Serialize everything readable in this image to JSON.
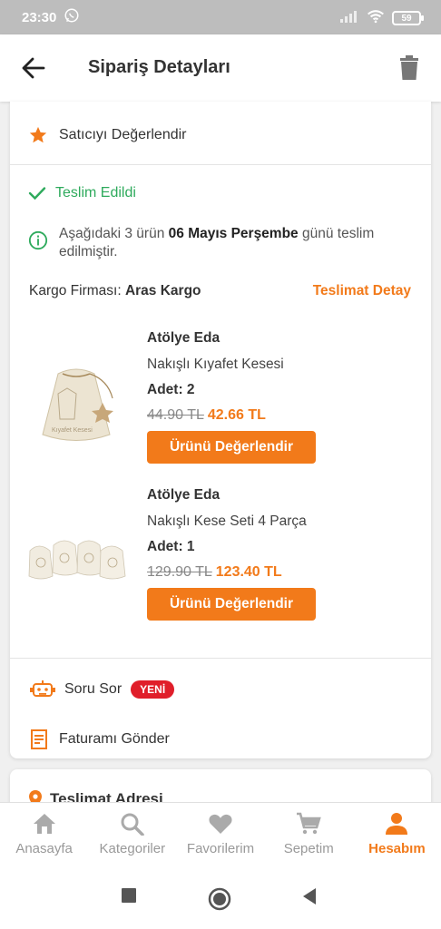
{
  "status_bar": {
    "time": "23:30",
    "battery": "59"
  },
  "header": {
    "title": "Sipariş Detayları"
  },
  "order": {
    "rate_seller": "Satıcıyı Değerlendir",
    "status": "Teslim Edildi",
    "info_prefix": "Aşağıdaki 3 ürün ",
    "info_date": "06 Mayıs Perşembe",
    "info_suffix": " günü teslim edilmiştir.",
    "cargo_label": "Kargo Firması: ",
    "cargo_name": "Aras Kargo",
    "delivery_detail": "Teslimat Detay",
    "products": [
      {
        "seller": "Atölye Eda",
        "name": "Nakışlı Kıyafet Kesesi",
        "qty": "Adet: 2",
        "old_price": "44.90 TL",
        "new_price": "42.66 TL",
        "rate_label": "Ürünü Değerlendir"
      },
      {
        "seller": "Atölye Eda",
        "name": "Nakışlı Kese Seti 4 Parça",
        "qty": "Adet: 1",
        "old_price": "129.90 TL",
        "new_price": "123.40 TL",
        "rate_label": "Ürünü Değerlendir"
      }
    ],
    "ask_question": "Soru Sor",
    "new_badge": "YENİ",
    "send_invoice": "Faturamı Gönder"
  },
  "address": {
    "title": "Teslimat Adresi"
  },
  "bottom_nav": [
    {
      "label": "Anasayfa",
      "icon": "home-icon"
    },
    {
      "label": "Kategoriler",
      "icon": "search-icon"
    },
    {
      "label": "Favorilerim",
      "icon": "heart-icon"
    },
    {
      "label": "Sepetim",
      "icon": "cart-icon"
    },
    {
      "label": "Hesabım",
      "icon": "person-icon",
      "active": true
    }
  ],
  "colors": {
    "accent": "#f27a1a",
    "success": "#2eaa5c",
    "badge": "#e01e2a"
  }
}
